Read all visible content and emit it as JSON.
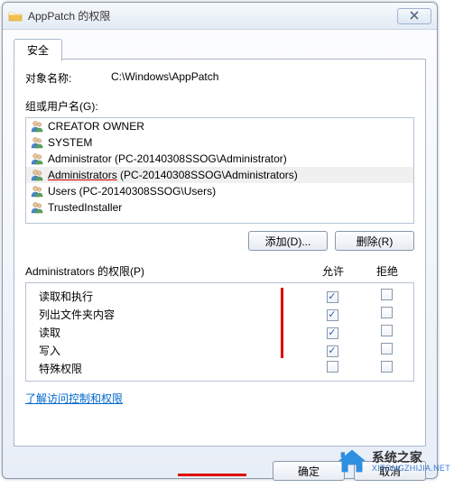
{
  "window": {
    "title": "AppPatch 的权限"
  },
  "tab": {
    "label": "安全"
  },
  "object": {
    "label": "对象名称:",
    "value": "C:\\Windows\\AppPatch"
  },
  "groups": {
    "label": "组或用户名(G):",
    "items": [
      {
        "text": "CREATOR OWNER"
      },
      {
        "text": "SYSTEM"
      },
      {
        "text": "Administrator (PC-20140308SSOG\\Administrator)"
      },
      {
        "text": "Administrators (PC-20140308SSOG\\Administrators)",
        "selected": true,
        "underline_first": true
      },
      {
        "text": "Users (PC-20140308SSOG\\Users)"
      },
      {
        "text": "TrustedInstaller"
      }
    ]
  },
  "buttons": {
    "add": "添加(D)...",
    "remove": "删除(R)"
  },
  "perm": {
    "title": "Administrators 的权限(P)",
    "col_allow": "允许",
    "col_deny": "拒绝",
    "rows": [
      {
        "label": "读取和执行",
        "allow": true,
        "deny": false
      },
      {
        "label": "列出文件夹内容",
        "allow": true,
        "deny": false
      },
      {
        "label": "读取",
        "allow": true,
        "deny": false
      },
      {
        "label": "写入",
        "allow": true,
        "deny": false
      },
      {
        "label": "特殊权限",
        "allow": false,
        "deny": false
      }
    ]
  },
  "link": {
    "text": "了解访问控制和权限"
  },
  "footer": {
    "ok": "确定",
    "cancel": "取消"
  },
  "watermark": {
    "cn": "系统之家",
    "en": "XITONGZHIJIA.NET"
  }
}
